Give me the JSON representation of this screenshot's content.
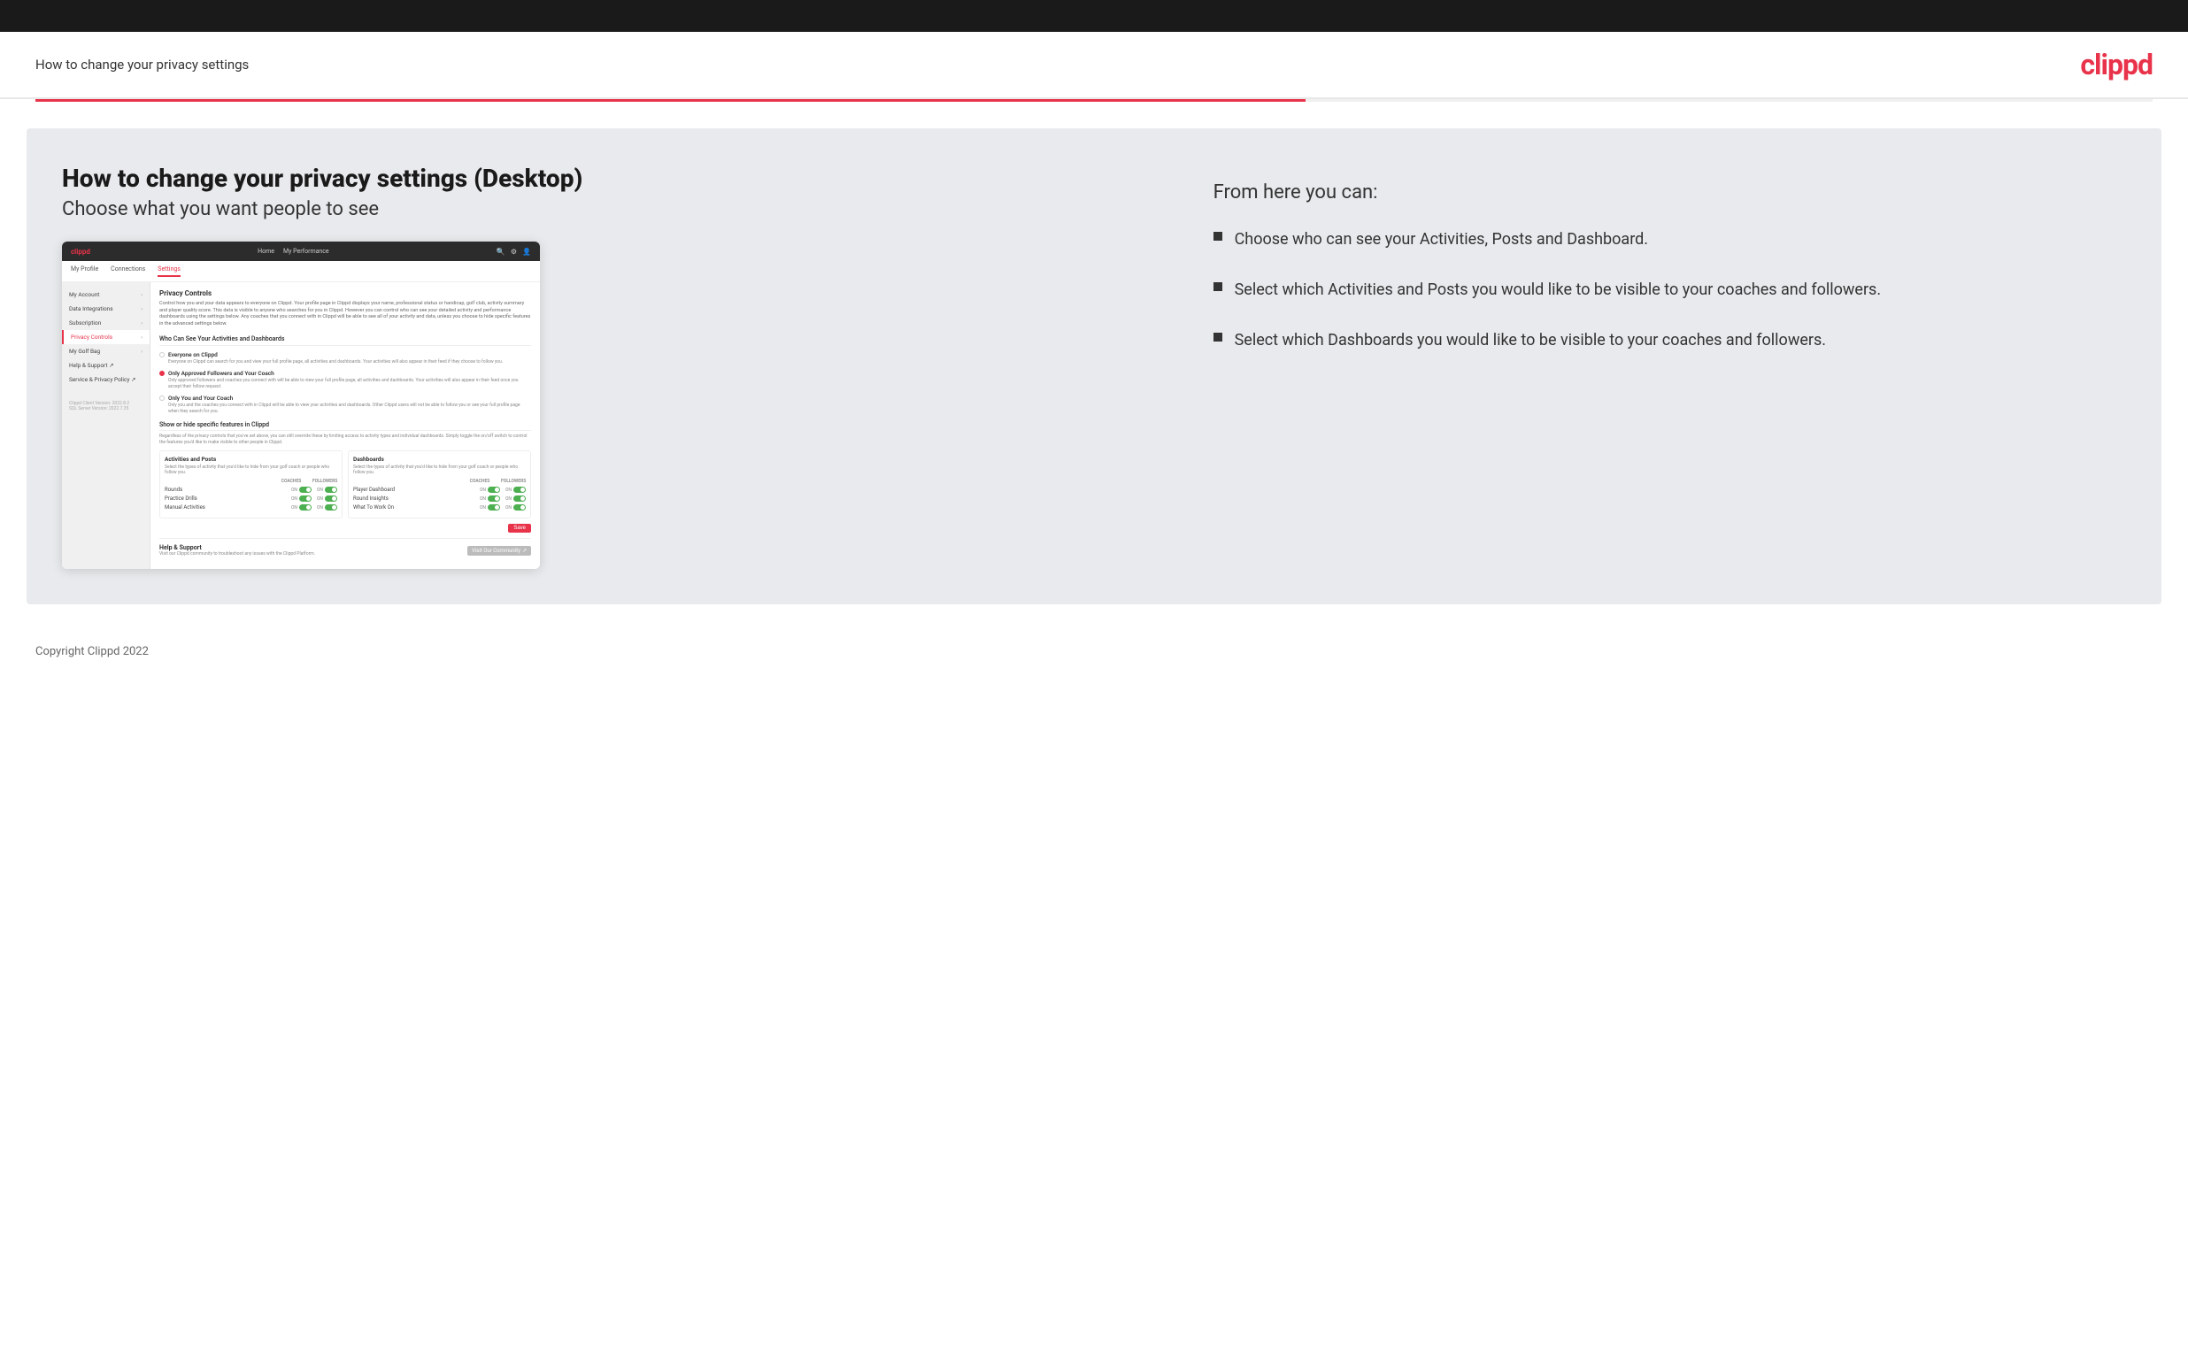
{
  "header": {
    "title": "How to change your privacy settings",
    "logo": "clippd"
  },
  "page": {
    "heading": "How to change your privacy settings (Desktop)",
    "subheading": "Choose what you want people to see"
  },
  "right_panel": {
    "from_here": "From here you can:",
    "bullets": [
      "Choose who can see your Activities, Posts and Dashboard.",
      "Select which Activities and Posts you would like to be visible to your coaches and followers.",
      "Select which Dashboards you would like to be visible to your coaches and followers."
    ]
  },
  "mockup": {
    "navbar": {
      "logo": "clippd",
      "links": [
        "Home",
        "My Performance"
      ],
      "icons": [
        "🔍",
        "⚙",
        "👤"
      ]
    },
    "subnav": {
      "items": [
        "My Profile",
        "Connections",
        "Settings"
      ],
      "active": "Settings"
    },
    "sidebar": {
      "items": [
        {
          "label": "My Account",
          "active": false
        },
        {
          "label": "Data Integrations",
          "active": false
        },
        {
          "label": "Subscription",
          "active": false
        },
        {
          "label": "Privacy Controls",
          "active": true
        },
        {
          "label": "My Golf Bag",
          "active": false
        },
        {
          "label": "Help & Support",
          "active": false,
          "external": true
        },
        {
          "label": "Service & Privacy Policy",
          "active": false,
          "external": true
        }
      ],
      "version": "Clippd Client Version: 2022.8.2\nSQL Server Version: 2022.7.35"
    },
    "main": {
      "section_title": "Privacy Controls",
      "section_desc": "Control how you and your data appears to everyone on Clippd. Your profile page in Clippd displays your name, professional status or handicap, golf club, activity summary and player quality score. This data is visible to anyone who searches for you in Clippd. However you can control who can see your detailed activity and performance dashboards using the settings below. Any coaches that you connect with in Clippd will be able to see all of your activity and data, unless you choose to hide specific features in the advanced settings below.",
      "who_title": "Who Can See Your Activities and Dashboards",
      "radio_options": [
        {
          "label": "Everyone on Clippd",
          "desc": "Everyone on Clippd can search for you and view your full profile page, all activities and dashboards. Your activities will also appear in their feed if they choose to follow you.",
          "selected": false
        },
        {
          "label": "Only Approved Followers and Your Coach",
          "desc": "Only approved followers and coaches you connect with will be able to view your full profile page, all activities and dashboards. Your activities will also appear in their feed once you accept their follow request.",
          "selected": true
        },
        {
          "label": "Only You and Your Coach",
          "desc": "Only you and the coaches you connect with in Clippd will be able to view your activities and dashboards. Other Clippd users will not be able to follow you or see your full profile page when they search for you.",
          "selected": false
        }
      ],
      "show_hide_title": "Show or hide specific features in Clippd",
      "show_hide_desc": "Regardless of the privacy controls that you've set above, you can still override these by limiting access to activity types and individual dashboards. Simply toggle the on/off switch to control the features you'd like to make visible to other people in Clippd.",
      "activities_posts": {
        "title": "Activities and Posts",
        "desc": "Select the types of activity that you'd like to hide from your golf coach or people who follow you.",
        "rows": [
          {
            "label": "Rounds",
            "coaches": "ON",
            "followers": "ON"
          },
          {
            "label": "Practice Drills",
            "coaches": "ON",
            "followers": "ON"
          },
          {
            "label": "Manual Activities",
            "coaches": "ON",
            "followers": "ON"
          }
        ]
      },
      "dashboards": {
        "title": "Dashboards",
        "desc": "Select the types of activity that you'd like to hide from your golf coach or people who follow you.",
        "rows": [
          {
            "label": "Player Dashboard",
            "coaches": "ON",
            "followers": "ON"
          },
          {
            "label": "Round Insights",
            "coaches": "ON",
            "followers": "ON"
          },
          {
            "label": "What To Work On",
            "coaches": "ON",
            "followers": "ON"
          }
        ]
      },
      "save_label": "Save",
      "help": {
        "title": "Help & Support",
        "desc": "Visit our Clippd community to troubleshoot any issues with the Clippd Platform.",
        "btn_label": "Visit Our Community"
      }
    }
  },
  "footer": {
    "text": "Copyright Clippd 2022"
  }
}
